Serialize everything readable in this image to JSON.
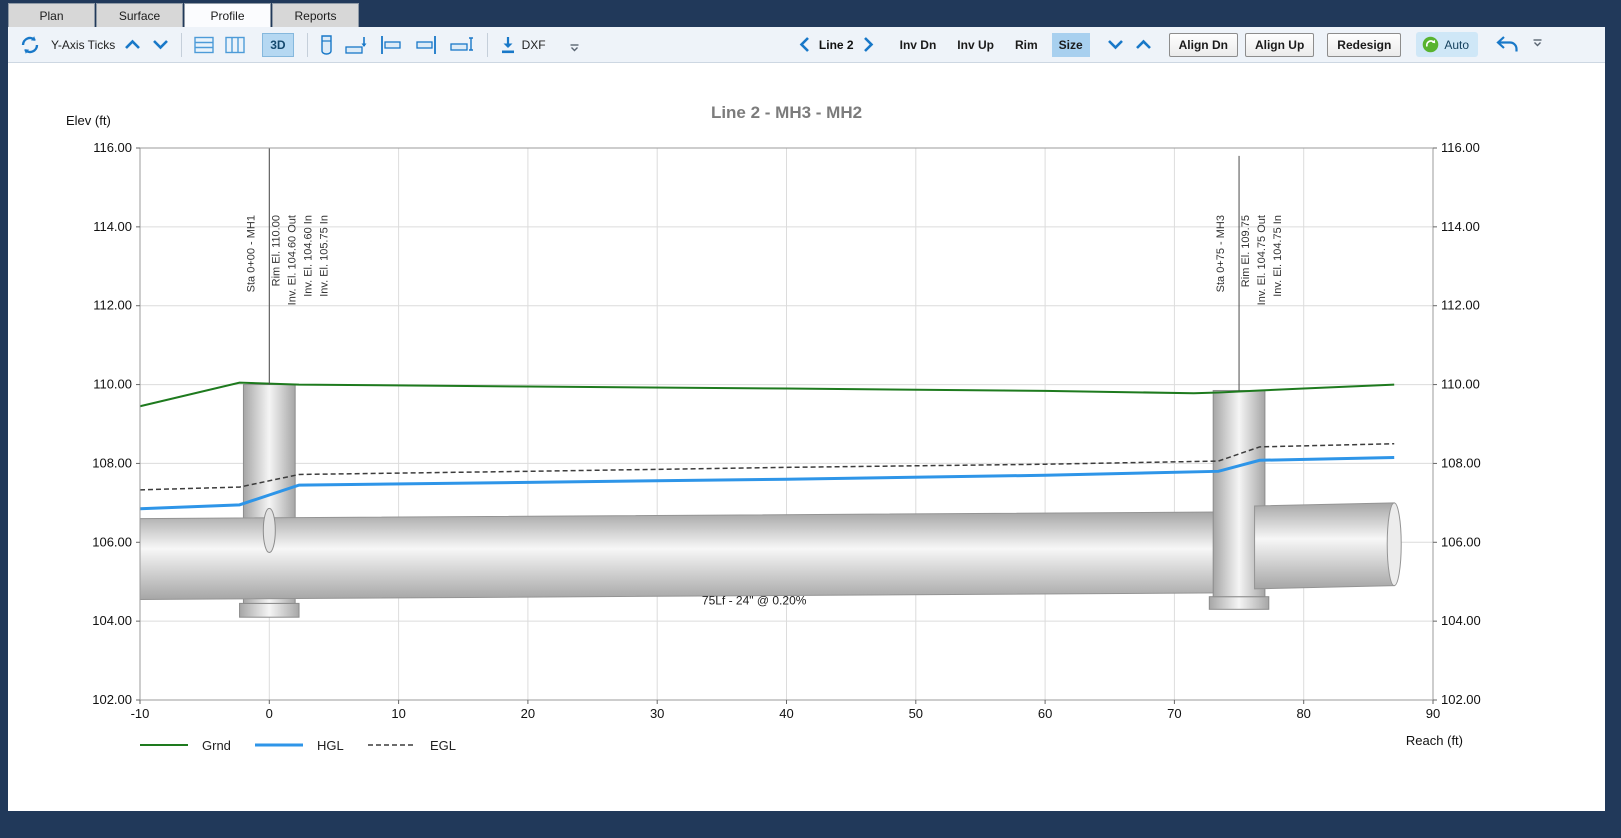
{
  "window": {
    "frame_color": "#21395a"
  },
  "tabs": [
    {
      "label": "Plan",
      "active": false
    },
    {
      "label": "Surface",
      "active": false
    },
    {
      "label": "Profile",
      "active": true
    },
    {
      "label": "Reports",
      "active": false
    }
  ],
  "toolbar": {
    "y_axis_ticks": "Y-Axis Ticks",
    "three_d": "3D",
    "dxf": "DXF",
    "line_name": "Line 2",
    "display_toggles": [
      {
        "label": "Inv Dn",
        "selected": false
      },
      {
        "label": "Inv Up",
        "selected": false
      },
      {
        "label": "Rim",
        "selected": false
      },
      {
        "label": "Size",
        "selected": true
      }
    ],
    "align_dn": "Align Dn",
    "align_up": "Align Up",
    "redesign": "Redesign",
    "auto": "Auto",
    "accent_color": "#1878c8",
    "selected_bg": "#a8d0ef"
  },
  "icons": {
    "refresh": "circular-arrows",
    "y_ticks_increase": "chevron-up",
    "y_ticks_decrease": "chevron-down",
    "grid_rows": "box-horizontal-lines",
    "grid_cols": "box-vertical-lines",
    "manhole": "cylinder",
    "pipe_invert_drop": "pipe-with-down-arrow",
    "pipe_align_downstream": "bar-left-pipe",
    "pipe_align_upstream": "bar-right-pipe",
    "pipe_extend": "pipe-with-ruler",
    "dxf_export": "download-arrow",
    "prev_line": "chevron-left",
    "next_line": "chevron-right",
    "size_decrease": "chevron-down",
    "size_increase": "chevron-up",
    "auto_status": "green-circle-refresh",
    "undo": "undo-arrow",
    "overflow": "line-with-chevron-down"
  },
  "chart_data": {
    "type": "line",
    "title": "Line 2 - MH3 - MH2",
    "title_color": "#7c7c7c",
    "ylabel": "Elev (ft)",
    "xlabel": "Reach (ft)",
    "xlim": [
      -10,
      90
    ],
    "ylim": [
      102,
      116
    ],
    "xticks": [
      -10,
      0,
      10,
      20,
      30,
      40,
      50,
      60,
      70,
      80,
      90
    ],
    "yticks": [
      102,
      104,
      106,
      108,
      110,
      112,
      114,
      116
    ],
    "grid": true,
    "grid_color": "#dcdcdc",
    "legend_position": "bottom-left",
    "series": [
      {
        "name": "Grnd",
        "color": "#1e7a1e",
        "width": 2,
        "dash": "",
        "points": [
          [
            -10,
            109.45
          ],
          [
            -2.3,
            110.05
          ],
          [
            2.3,
            110.0
          ],
          [
            20,
            109.95
          ],
          [
            40,
            109.9
          ],
          [
            60,
            109.84
          ],
          [
            71.5,
            109.78
          ],
          [
            73.4,
            109.8
          ],
          [
            76.6,
            109.85
          ],
          [
            80,
            109.9
          ],
          [
            87,
            110.0
          ]
        ]
      },
      {
        "name": "HGL",
        "color": "#2e95e8",
        "width": 3,
        "dash": "",
        "points": [
          [
            -10,
            106.85
          ],
          [
            -2.3,
            106.95
          ],
          [
            2.3,
            107.45
          ],
          [
            20,
            107.52
          ],
          [
            40,
            107.6
          ],
          [
            60,
            107.7
          ],
          [
            73.4,
            107.8
          ],
          [
            76.6,
            108.08
          ],
          [
            87,
            108.15
          ]
        ]
      },
      {
        "name": "EGL",
        "color": "#3c3c3c",
        "width": 1.5,
        "dash": "5,3",
        "points": [
          [
            -10,
            107.33
          ],
          [
            -2.3,
            107.4
          ],
          [
            2.3,
            107.72
          ],
          [
            20,
            107.8
          ],
          [
            40,
            107.9
          ],
          [
            60,
            107.98
          ],
          [
            73.4,
            108.06
          ],
          [
            76.6,
            108.42
          ],
          [
            87,
            108.5
          ]
        ]
      }
    ],
    "pipes": [
      {
        "x1": -10,
        "x2": 74.8,
        "invert1": 104.55,
        "invert2": 104.72,
        "diameter": 2.05,
        "end_cap": false
      },
      {
        "x1": 76.2,
        "x2": 87,
        "invert1": 104.82,
        "invert2": 104.9,
        "diameter": 2.1,
        "end_cap": true
      }
    ],
    "structures": [
      {
        "name": "MH1",
        "x": 0,
        "half_width": 2.0,
        "top": 110.0,
        "bottom": 104.45,
        "base_half_width": 2.3,
        "base_bottom": 104.1
      },
      {
        "name": "MH3",
        "x": 75,
        "half_width": 2.0,
        "top": 109.85,
        "bottom": 104.62,
        "base_half_width": 2.3,
        "base_bottom": 104.3
      }
    ],
    "inlet_pipe_end": {
      "x": 0,
      "center_elev": 106.3,
      "ry": 0.56
    },
    "annotations": [
      {
        "x": 0,
        "line_top": 116.0,
        "line_bottom": 110.0,
        "labels": [
          "Sta 0+00 - MH1",
          "Rim El. 110.00",
          "Inv. El. 104.60 Out",
          "Inv. El. 104.60 In",
          "Inv. El. 105.75 In"
        ]
      },
      {
        "x": 75,
        "line_top": 115.8,
        "line_bottom": 109.85,
        "labels": [
          "Sta 0+75 - MH3",
          "Rim El. 109.75",
          "Inv. El. 104.75 Out",
          "Inv. El. 104.75 In"
        ]
      }
    ],
    "annotation_label_top_elev": 114.3,
    "pipe_label": {
      "x": 37.5,
      "elev": 104.42,
      "text": "75Lf - 24\" @ 0.20%"
    }
  }
}
